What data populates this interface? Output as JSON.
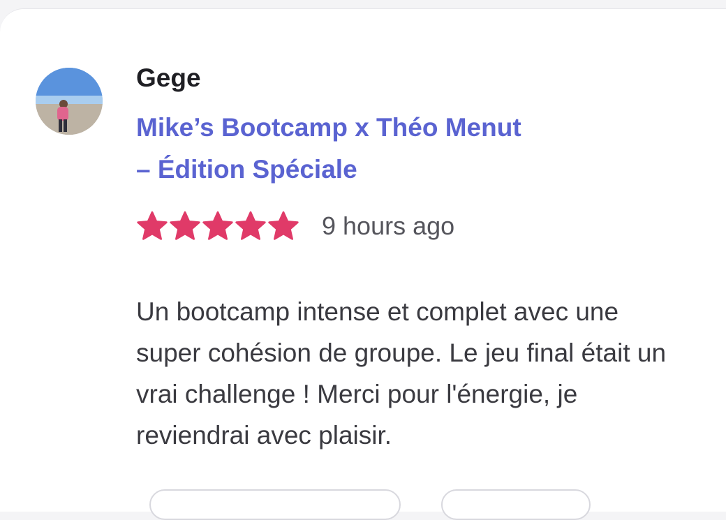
{
  "review": {
    "author": "Gege",
    "event_title": "Mike’s Bootcamp x Théo Menut – Édition Spéciale",
    "rating": 5,
    "rating_max": 5,
    "time_ago": "9 hours ago",
    "text": "Un bootcamp intense et complet avec une super cohésion de groupe. Le jeu final était un vrai challenge ! Merci pour l'énergie, je reviendrai avec plaisir."
  },
  "colors": {
    "star": "#e03a68",
    "link": "#5a63d1",
    "author": "#1f1f24",
    "text": "#3a3a40"
  },
  "icons": {
    "star": "star-icon"
  }
}
